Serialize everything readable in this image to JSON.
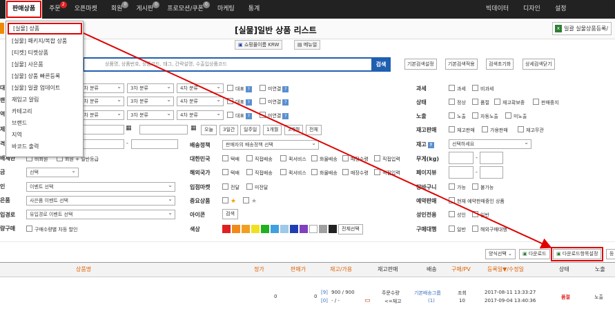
{
  "nav": {
    "items": [
      {
        "label": "판매상품",
        "badge": ""
      },
      {
        "label": "주문",
        "badge": "2"
      },
      {
        "label": "오픈마켓",
        "badge": ""
      },
      {
        "label": "회원",
        "badge": "0"
      },
      {
        "label": "게시판",
        "badge": "0"
      },
      {
        "label": "프로모션/쿠폰",
        "badge": "0"
      },
      {
        "label": "마케팅",
        "badge": ""
      },
      {
        "label": "통계",
        "badge": ""
      }
    ],
    "right": [
      "빅데이터",
      "디자인",
      "설정"
    ]
  },
  "page": {
    "title": "[실물]일반 상품 리스트",
    "bulk_register": "일괄 실물상품등록/",
    "shop_select": "쇼핑몰이름 KRW",
    "manual": "메뉴얼"
  },
  "dropdown": [
    "[실물] 상품",
    "[실물] 패키지/복합 상품",
    "[티켓] 티켓상품",
    "[실물] 사은품",
    "[실물] 상품 빠른등록",
    "[실물] 일괄 업데이트",
    "재입고 알림",
    "카테고리",
    "브랜드",
    "지역",
    "바코드 출력"
  ],
  "search": {
    "placeholder": "상품명, 상품번호, 상품코드, 태그, 간략설명, 수출입상품코드",
    "button": "검색",
    "options": [
      "기본검색설정",
      "기본검색적용",
      "검색초기화",
      "상세검색닫기"
    ]
  },
  "filters": {
    "category_levels": [
      "2차 분류",
      "3차 분류",
      "4차 분류"
    ],
    "rep_label": "대표",
    "unlinked_label": "미연결",
    "regdate_range": [
      "오늘",
      "3일간",
      "일주일",
      "1개월",
      "3개월",
      "전체"
    ],
    "ship_label": "배송정책",
    "ship_value": "판매자의 배송정책 선택",
    "domestic_label": "대한민국",
    "domestic_opts": [
      "택배",
      "직접배송",
      "퀵서비스",
      "화물배송",
      "매장수령",
      "직접입력"
    ],
    "overseas_label": "해외국가",
    "overseas_opts": [
      "택배",
      "직접배송",
      "퀵서비스",
      "화물배송",
      "매장수령",
      "직접입력"
    ],
    "openmarket_label": "입점마켓",
    "openmarket_opts": [
      "전달",
      "미전달"
    ],
    "important_label": "중요상품",
    "icon_label": "아이콘",
    "icon_btn": "검색",
    "color_label": "색상",
    "color_btn": "전체선택",
    "tax_label": "과세",
    "tax_opts": [
      "과세",
      "비과세"
    ],
    "status_label": "상태",
    "status_opts": [
      "정상",
      "품절",
      "재고확보중",
      "판매중지"
    ],
    "expose_label": "노출",
    "expose_opts": [
      "노출",
      "자동노출",
      "미노출"
    ],
    "stock_sale_label": "재고판매",
    "stock_sale_opts": [
      "재고판매",
      "가용판매",
      "재고무관"
    ],
    "stock_label": "재고",
    "stock_value": "선택하세요",
    "weight_label": "무게(kg)",
    "pages_label": "페이지뷰",
    "cart_label": "장바구니",
    "cart_opts": [
      "가능",
      "불가능"
    ],
    "reserve_label": "예약판매",
    "reserve_opts": [
      "현재 예약판매중인 상품"
    ],
    "adult_label": "성인전용",
    "adult_opts": [
      "성인",
      "일반"
    ],
    "agency_label": "구매대행",
    "agency_opts": [
      "일반",
      "해외구매대행"
    ],
    "left_partial": [
      "대",
      "랜",
      "역",
      "제",
      "격",
      "배제한",
      "금",
      "인",
      "은품",
      "입경로",
      "량구매"
    ],
    "member_opts": [
      "비회원",
      "회원 + 일반등급"
    ],
    "sel_select": "선택",
    "event_select": "이벤트 선택",
    "gift_select": "사은품 이벤트 선택",
    "inflow_select": "유입경로 이벤트 선택",
    "bulk_discount": "구매수량별 차등 할인",
    "colors": [
      "#e02020",
      "#f08a1c",
      "#f0a020",
      "#f0e020",
      "#20b020",
      "#40a0e0",
      "#a0c8e8",
      "#1f3fb0",
      "#8040c0",
      "#ffffff",
      "#a0a0a0",
      "#222222"
    ]
  },
  "listbar": {
    "form_select": "양식선택",
    "download": "다운로드",
    "download_setting": "다운로드항목설정",
    "register": "등"
  },
  "table": {
    "headers": [
      "상품명",
      "정가",
      "판매가",
      "재고/가용",
      "재고판매",
      "배송",
      "구매/PV",
      "등록일▼/수정일",
      "상태",
      "노출"
    ],
    "row": {
      "price": "0",
      "sale": "0",
      "stock_a": "[9]",
      "stock_b": "900 / 900",
      "stock_c": "[0]",
      "stock_d": "- / -",
      "stock_sale": "주문수량",
      "stock_sale2": "<=재고",
      "ship": "기본배송그룹",
      "ship2": "(1)",
      "buy": "조회",
      "buy2": "10",
      "regdate": "2017-08-11 13:33:27",
      "moddate": "2017-09-04 13:40:36",
      "status": "품절",
      "expose": "노출"
    }
  }
}
